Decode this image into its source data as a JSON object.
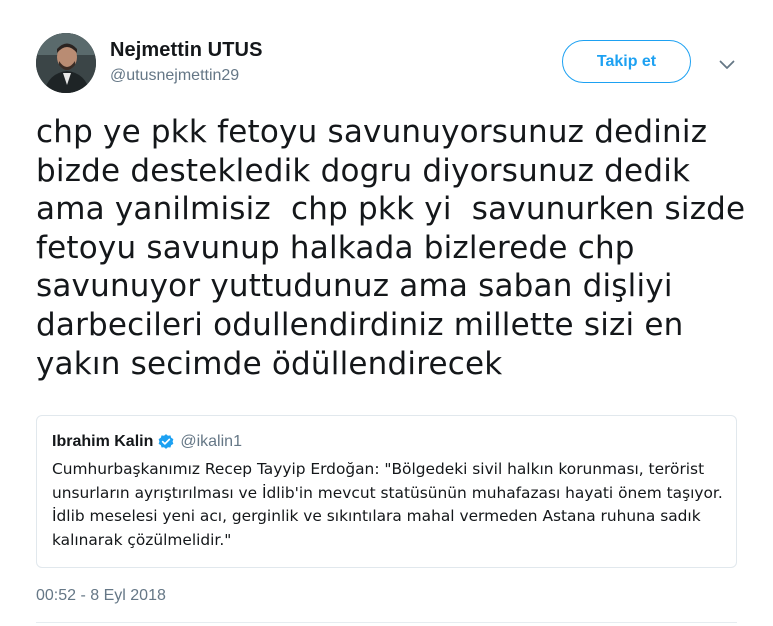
{
  "author": {
    "name": "Nejmettin UTUS",
    "handle": "@utusnejmettin29"
  },
  "actions": {
    "follow_label": "Takip et"
  },
  "tweet": {
    "lines": [
      "chp ye pkk fetoyu savunuyorsunuz dediniz",
      "bizde destekledik dogru diyorsunuz dedik",
      "ama yanilmisiz  chp pkk yi  savunurken sizde",
      "fetoyu savunup halkada bizlerede chp",
      "savunuyor yuttudunuz ama saban dişliyi",
      "darbecileri odullendirdiniz millette sizi en",
      "yakın secimde ödüllendirecek"
    ],
    "timestamp": "00:52 - 8 Eyl 2018"
  },
  "quoted": {
    "name": "Ibrahim Kalin",
    "handle": "@ikalin1",
    "verified": true,
    "lines": [
      "Cumhurbaşkanımız Recep Tayyip Erdoğan: \"Bölgedeki sivil halkın korunması, terörist",
      "unsurların ayrıştırılması ve İdlib'in mevcut statüsünün muhafazası hayati önem taşıyor.",
      "İdlib meselesi yeni acı, gerginlik ve sıkıntılara mahal vermeden Astana ruhuna sadık",
      "kalınarak çözülmelidir.\""
    ]
  },
  "colors": {
    "accent": "#1da1f2",
    "text": "#14171a",
    "secondary": "#657786",
    "border": "#e1e8ed"
  },
  "icons": {
    "caret": "chevron-down-icon",
    "verified": "verified-badge-icon"
  }
}
